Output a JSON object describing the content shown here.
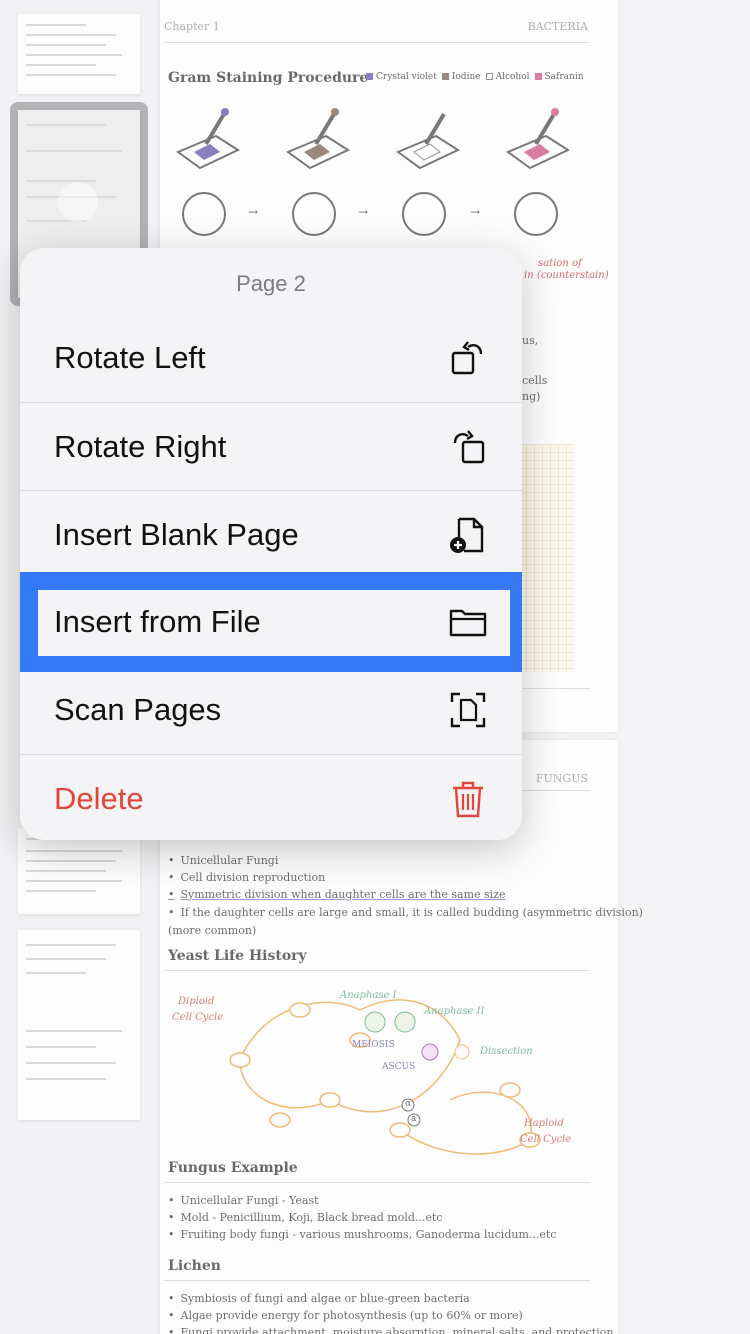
{
  "document": {
    "page1": {
      "running_head_left": "Chapter 1",
      "running_head_right": "BACTERIA",
      "section_title": "Gram Staining Procedure",
      "legend": [
        "Crystal violet",
        "Iodine",
        "Alcohol",
        "Safranin"
      ],
      "legend_colors": [
        "#4b3f9e",
        "#6b4a3a",
        "#ffffff",
        "#c93a72"
      ],
      "red_note_line1": "sation of",
      "red_note_line2": "in (counterstain)",
      "frag1": "us,",
      "frag2": "cells",
      "frag3": "ng)"
    },
    "page2": {
      "running_head_right": "FUNGUS",
      "bullets_top": [
        "Unicellular Fungi",
        "Cell division reproduction",
        "Symmetric division when daughter cells are the same size",
        "If the daughter cells are large and small, it is called budding (asymmetric division)"
      ],
      "bullets_top_cont": "(more common)",
      "yeast_title": "Yeast Life History",
      "diagram_labels": {
        "diploid": "Diploid",
        "diploid2": "Cell Cycle",
        "anaphase1": "Anaphase I",
        "anaphase2": "Anaphase II",
        "meiosis": "MEIOSIS",
        "ascus": "ASCUS",
        "dissection": "Dissection",
        "haploid": "Haploid",
        "haploid2": "Cell Cycle",
        "alpha": "α",
        "a": "a"
      },
      "fungus_title": "Fungus Example",
      "fungus_bullets": [
        "Unicellular Fungi - Yeast",
        "Mold - Penicillium, Koji, Black bread mold...etc",
        "Fruiting body fungi - various mushrooms, Ganoderma lucidum...etc"
      ],
      "lichen_title": "Lichen",
      "lichen_bullets": [
        "Symbiosis of fungi and algae or blue-green bacteria",
        "Algae provide energy for photosynthesis (up to 60% or more)",
        "Fungi provide attachment, moisture absorption, mineral salts, and protection"
      ]
    }
  },
  "menu": {
    "title": "Page 2",
    "items": [
      {
        "label": "Rotate Left",
        "icon": "rotate-left-icon"
      },
      {
        "label": "Rotate Right",
        "icon": "rotate-right-icon"
      },
      {
        "label": "Insert Blank Page",
        "icon": "insert-blank-page-icon"
      },
      {
        "label": "Insert from File",
        "icon": "folder-icon"
      },
      {
        "label": "Scan Pages",
        "icon": "scan-pages-icon"
      },
      {
        "label": "Delete",
        "icon": "trash-icon"
      }
    ],
    "highlight_color": "#3478f6",
    "delete_color": "#e0463a"
  }
}
